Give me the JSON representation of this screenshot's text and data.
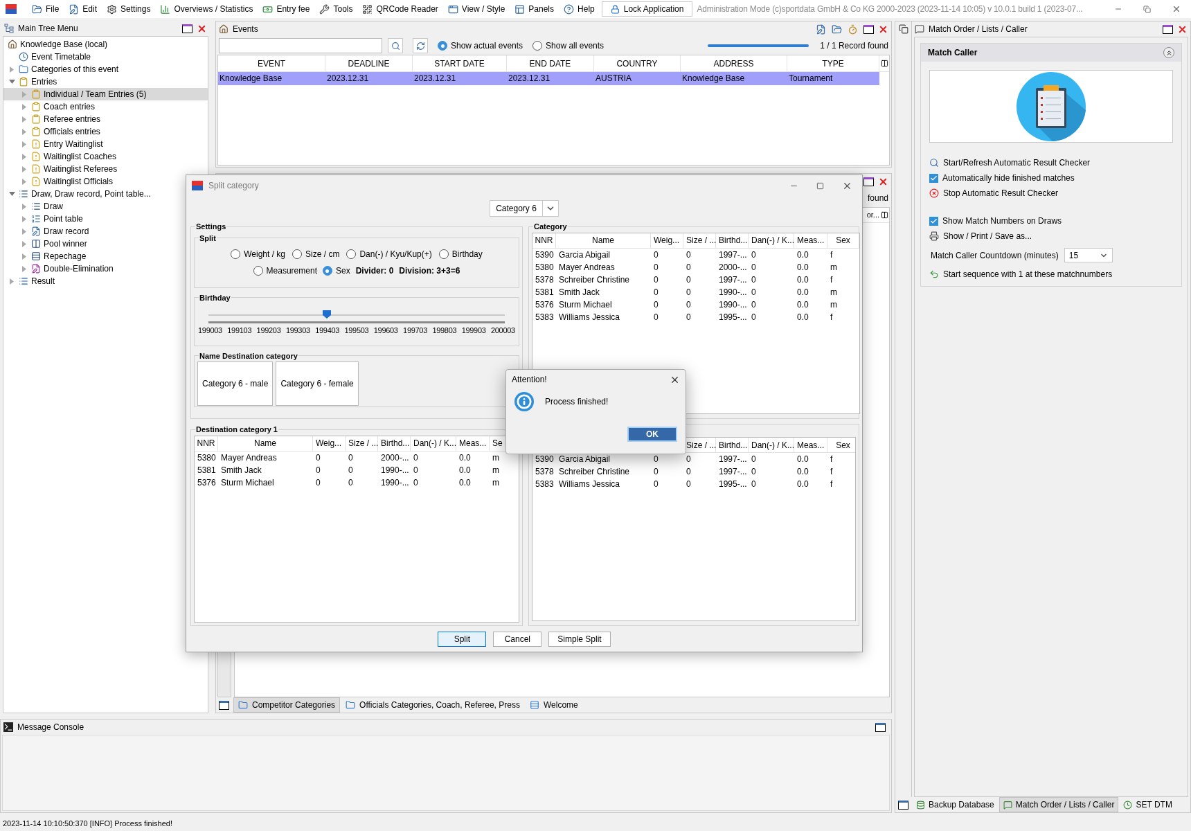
{
  "menu_bar": {
    "items": [
      "File",
      "Edit",
      "Settings",
      "Overviews / Statistics",
      "Entry fee",
      "Tools",
      "QRCode Reader",
      "View / Style",
      "Panels",
      "Help"
    ],
    "lock_button": "Lock Application",
    "title": "Administration Mode (c)sportdata GmbH & Co KG 2000-2023 (2023-11-14 10:05) v 10.0.1 build 1 (2023-07..."
  },
  "tree": {
    "title": "Main Tree Menu",
    "root": "Knowledge Base (local)",
    "items": [
      {
        "label": "Event Timetable",
        "selected": false
      },
      {
        "label": "Categories of this event",
        "expanded": false,
        "selected": false
      },
      {
        "label": "Entries",
        "expanded": true,
        "selected": false,
        "children": [
          {
            "label": "Individual / Team Entries (5)",
            "expanded": false,
            "selected": true
          },
          {
            "label": "Coach entries",
            "expanded": false,
            "selected": false
          },
          {
            "label": "Referee entries",
            "expanded": false,
            "selected": false
          },
          {
            "label": "Officials entries",
            "expanded": false,
            "selected": false
          },
          {
            "label": "Entry Waitinglist",
            "expanded": false,
            "selected": false
          },
          {
            "label": "Waitinglist Coaches",
            "expanded": false,
            "selected": false
          },
          {
            "label": "Waitinglist Referees",
            "expanded": false,
            "selected": false
          },
          {
            "label": "Waitinglist Officials",
            "expanded": false,
            "selected": false
          }
        ]
      },
      {
        "label": "Draw, Draw record, Point table...",
        "expanded": true,
        "selected": false,
        "children": [
          {
            "label": "Draw",
            "expanded": false,
            "selected": false
          },
          {
            "label": "Point table",
            "expanded": false,
            "selected": false
          },
          {
            "label": "Draw record",
            "expanded": false,
            "selected": false
          },
          {
            "label": "Pool winner",
            "expanded": false,
            "selected": false
          },
          {
            "label": "Repechage",
            "expanded": false,
            "selected": false
          },
          {
            "label": "Double-Elimination",
            "expanded": false,
            "selected": false
          }
        ]
      },
      {
        "label": "Result",
        "expanded": false,
        "selected": false
      }
    ]
  },
  "events": {
    "title": "Events",
    "filters": [
      {
        "label": "Show actual events",
        "selected": true
      },
      {
        "label": "Show all events",
        "selected": false
      }
    ],
    "progress": {
      "level": 1
    },
    "record_count": "1 / 1 Record found",
    "columns": [
      "EVENT",
      "DEADLINE",
      "START DATE",
      "END DATE",
      "COUNTRY",
      "ADDRESS",
      "TYPE"
    ],
    "rows": [
      {
        "cells": [
          "Knowledge Base",
          "2023.12.31",
          "2023.12.31",
          "2023.12.31",
          "AUSTRIA",
          "Knowledge Base",
          "Tournament"
        ],
        "selected": true
      }
    ]
  },
  "categories_panel": {
    "status": "found",
    "column_header": "or...",
    "tabs": [
      {
        "label": "Competitor Categories",
        "selected": true
      },
      {
        "label": "Officials Categories, Coach, Referee, Press",
        "selected": false
      },
      {
        "label": "Welcome",
        "selected": false
      }
    ]
  },
  "console": {
    "title": "Message Console"
  },
  "match_caller": {
    "panel_title": "Match Order / Lists / Caller",
    "section_title": "Match Caller",
    "groups": [
      [
        {
          "kind": "action",
          "label": "Start/Refresh Automatic Result Checker"
        },
        {
          "kind": "checkbox",
          "label": "Automatically hide finished matches",
          "checked": true
        },
        {
          "kind": "action",
          "label": "Stop Automatic Result Checker"
        }
      ],
      [
        {
          "kind": "checkbox",
          "label": "Show Match Numbers on Draws",
          "checked": true
        },
        {
          "kind": "action",
          "label": "Show / Print / Save as..."
        }
      ]
    ],
    "countdown": {
      "label": "Match Caller Countdown (minutes)",
      "value": "15"
    },
    "sequence": "Start sequence with 1 at these matchnumbers",
    "tabs": [
      {
        "label": "Backup Database",
        "selected": false
      },
      {
        "label": "Match Order / Lists / Caller",
        "selected": true
      },
      {
        "label": "SET DTM",
        "selected": false
      }
    ]
  },
  "split_dialog": {
    "title": "Split category",
    "category": "Category 6",
    "settings_label": "Settings",
    "split_label": "Split",
    "split_options": [
      {
        "label": "Weight / kg",
        "selected": false
      },
      {
        "label": "Size / cm",
        "selected": false
      },
      {
        "label": "Dan(-) / Kyu/Kup(+)",
        "selected": false
      },
      {
        "label": "Birthday",
        "selected": false
      },
      {
        "label": "Measurement",
        "selected": false
      },
      {
        "label": "Sex",
        "selected": true
      }
    ],
    "divider": "Divider: 0",
    "division": "Division: 3+3=6",
    "birthday_label": "Birthday",
    "birthday_slider": {
      "level": 0.4,
      "ticks": [
        "199003",
        "199103",
        "199203",
        "199303",
        "199403",
        "199503",
        "199603",
        "199703",
        "199803",
        "199903",
        "200003"
      ]
    },
    "name_label": "Name Destination category",
    "names": [
      "Category 6 - male",
      "Category 6 - female"
    ],
    "category_label": "Category",
    "category_table": {
      "columns": [
        "NNR",
        "Name",
        "Weig...",
        "Size / ...",
        "Birthd...",
        "Dan(-) / K...",
        "Meas...",
        "Sex"
      ],
      "rows": [
        [
          "5390",
          "Garcia Abigail",
          "0",
          "0",
          "1997-...",
          "0",
          "0.0",
          "f"
        ],
        [
          "5380",
          "Mayer Andreas",
          "0",
          "0",
          "2000-...",
          "0",
          "0.0",
          "m"
        ],
        [
          "5378",
          "Schreiber Christine",
          "0",
          "0",
          "1997-...",
          "0",
          "0.0",
          "f"
        ],
        [
          "5381",
          "Smith Jack",
          "0",
          "0",
          "1990-...",
          "0",
          "0.0",
          "m"
        ],
        [
          "5376",
          "Sturm Michael",
          "0",
          "0",
          "1990-...",
          "0",
          "0.0",
          "m"
        ],
        [
          "5383",
          "Williams Jessica",
          "0",
          "0",
          "1995-...",
          "0",
          "0.0",
          "f"
        ]
      ]
    },
    "dest1_label": "Destination category 1",
    "dest1_table": {
      "columns": [
        "NNR",
        "Name",
        "Weig...",
        "Size / ...",
        "Birthd...",
        "Dan(-) / K...",
        "Meas...",
        "Se"
      ],
      "rows": [
        [
          "5380",
          "Mayer Andreas",
          "0",
          "0",
          "2000-...",
          "0",
          "0.0",
          "m"
        ],
        [
          "5381",
          "Smith Jack",
          "0",
          "0",
          "1990-...",
          "0",
          "0.0",
          "m"
        ],
        [
          "5376",
          "Sturm Michael",
          "0",
          "0",
          "1990-...",
          "0",
          "0.0",
          "m"
        ]
      ]
    },
    "dest2_table": {
      "columns": [
        "",
        "",
        "",
        "Size / ...",
        "Birthd...",
        "Dan(-) / K...",
        "Meas...",
        "Sex"
      ],
      "rows": [
        [
          "5390",
          "Garcia Abigail",
          "0",
          "0",
          "1997-...",
          "0",
          "0.0",
          "f"
        ],
        [
          "5378",
          "Schreiber Christine",
          "0",
          "0",
          "1997-...",
          "0",
          "0.0",
          "f"
        ],
        [
          "5383",
          "Williams Jessica",
          "0",
          "0",
          "1995-...",
          "0",
          "0.0",
          "f"
        ]
      ]
    },
    "buttons": [
      {
        "label": "Split",
        "focused": true
      },
      {
        "label": "Cancel",
        "focused": false
      },
      {
        "label": "Simple Split",
        "focused": false
      }
    ]
  },
  "alert": {
    "title": "Attention!",
    "message": "Process finished!",
    "ok": "OK"
  },
  "status_bar": {
    "text": "2023-11-14 10:10:50:370 [INFO] Process finished!"
  }
}
